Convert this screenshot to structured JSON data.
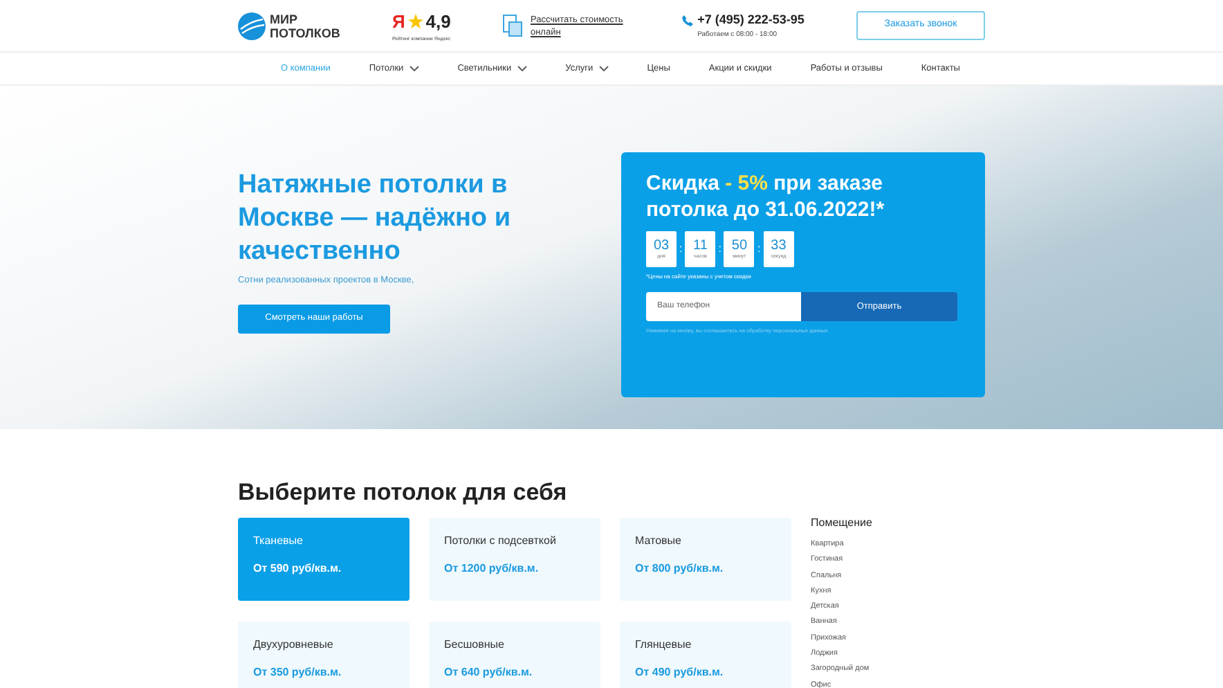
{
  "header": {
    "logo_text": [
      "МИР",
      "ПОТОЛКОВ"
    ],
    "rating": {
      "logo": "Я",
      "value": "4,9",
      "caption": "Рейтинг компании Яндекс"
    },
    "calc_link": "Рассчитать стоимость онлайн",
    "phone": "+7 (495) 222-53-95",
    "hours": "Работаем с 08:00 - 18:00",
    "callback_button": "Заказать звонок"
  },
  "nav": [
    {
      "label": "О компании",
      "selected": true,
      "dropdown": false
    },
    {
      "label": "Потолки",
      "selected": false,
      "dropdown": true
    },
    {
      "label": "Светильники",
      "selected": false,
      "dropdown": true
    },
    {
      "label": "Услуги",
      "selected": false,
      "dropdown": true
    },
    {
      "label": "Цены",
      "selected": false,
      "dropdown": false
    },
    {
      "label": "Акции и скидки",
      "selected": false,
      "dropdown": false
    },
    {
      "label": "Работы и отзывы",
      "selected": false,
      "dropdown": false
    },
    {
      "label": "Контакты",
      "selected": false,
      "dropdown": false
    }
  ],
  "hero": {
    "title": "Натяжные потолки в Москве — надёжно и качественно",
    "subtitle": "Сотни реализованных проектов в Москве,",
    "button": "Смотреть наши работы"
  },
  "offer": {
    "title": [
      {
        "text": "Скидка ",
        "highlight": false
      },
      {
        "text": "- 5%",
        "highlight": true
      },
      {
        "text": " при заказе потолка до 31.06.2022!*",
        "highlight": false
      }
    ],
    "timer": [
      {
        "value": "03",
        "label": "дня"
      },
      {
        "value": "11",
        "label": "часов"
      },
      {
        "value": "50",
        "label": "минут"
      },
      {
        "value": "33",
        "label": "секунд"
      }
    ],
    "separator": ":",
    "note": "*Цены на сайте указаны с учетом скидки",
    "phone_placeholder": "Ваш телефон",
    "submit": "Отправить",
    "consent": "Нажимая на кнопку, вы соглашаетесь на обработку персональных данных"
  },
  "catalog": {
    "title": "Выберите потолок для себя",
    "cards": [
      {
        "name": "Тканевые",
        "price": "От 590 руб/кв.м.",
        "selected": true
      },
      {
        "name": "Потолки с подсевткой",
        "price": "От 1200 руб/кв.м.",
        "selected": false
      },
      {
        "name": "Матовые",
        "price": "От 800 руб/кв.м.",
        "selected": false
      },
      {
        "name": "Двухуровневые",
        "price": "От 350 руб/кв.м.",
        "selected": false
      },
      {
        "name": "Бесшовные",
        "price": "От 640 руб/кв.м.",
        "selected": false
      },
      {
        "name": "Глянцевые",
        "price": "От 490 руб/кв.м.",
        "selected": false
      }
    ],
    "filter": {
      "title": "Помещение",
      "items": [
        "Квартира",
        "Гостиная",
        "Спальня",
        "Кухня",
        "Детская",
        "Ванная",
        "Прихожая",
        "Лоджия",
        "Загородный дом",
        "Офис"
      ]
    }
  }
}
